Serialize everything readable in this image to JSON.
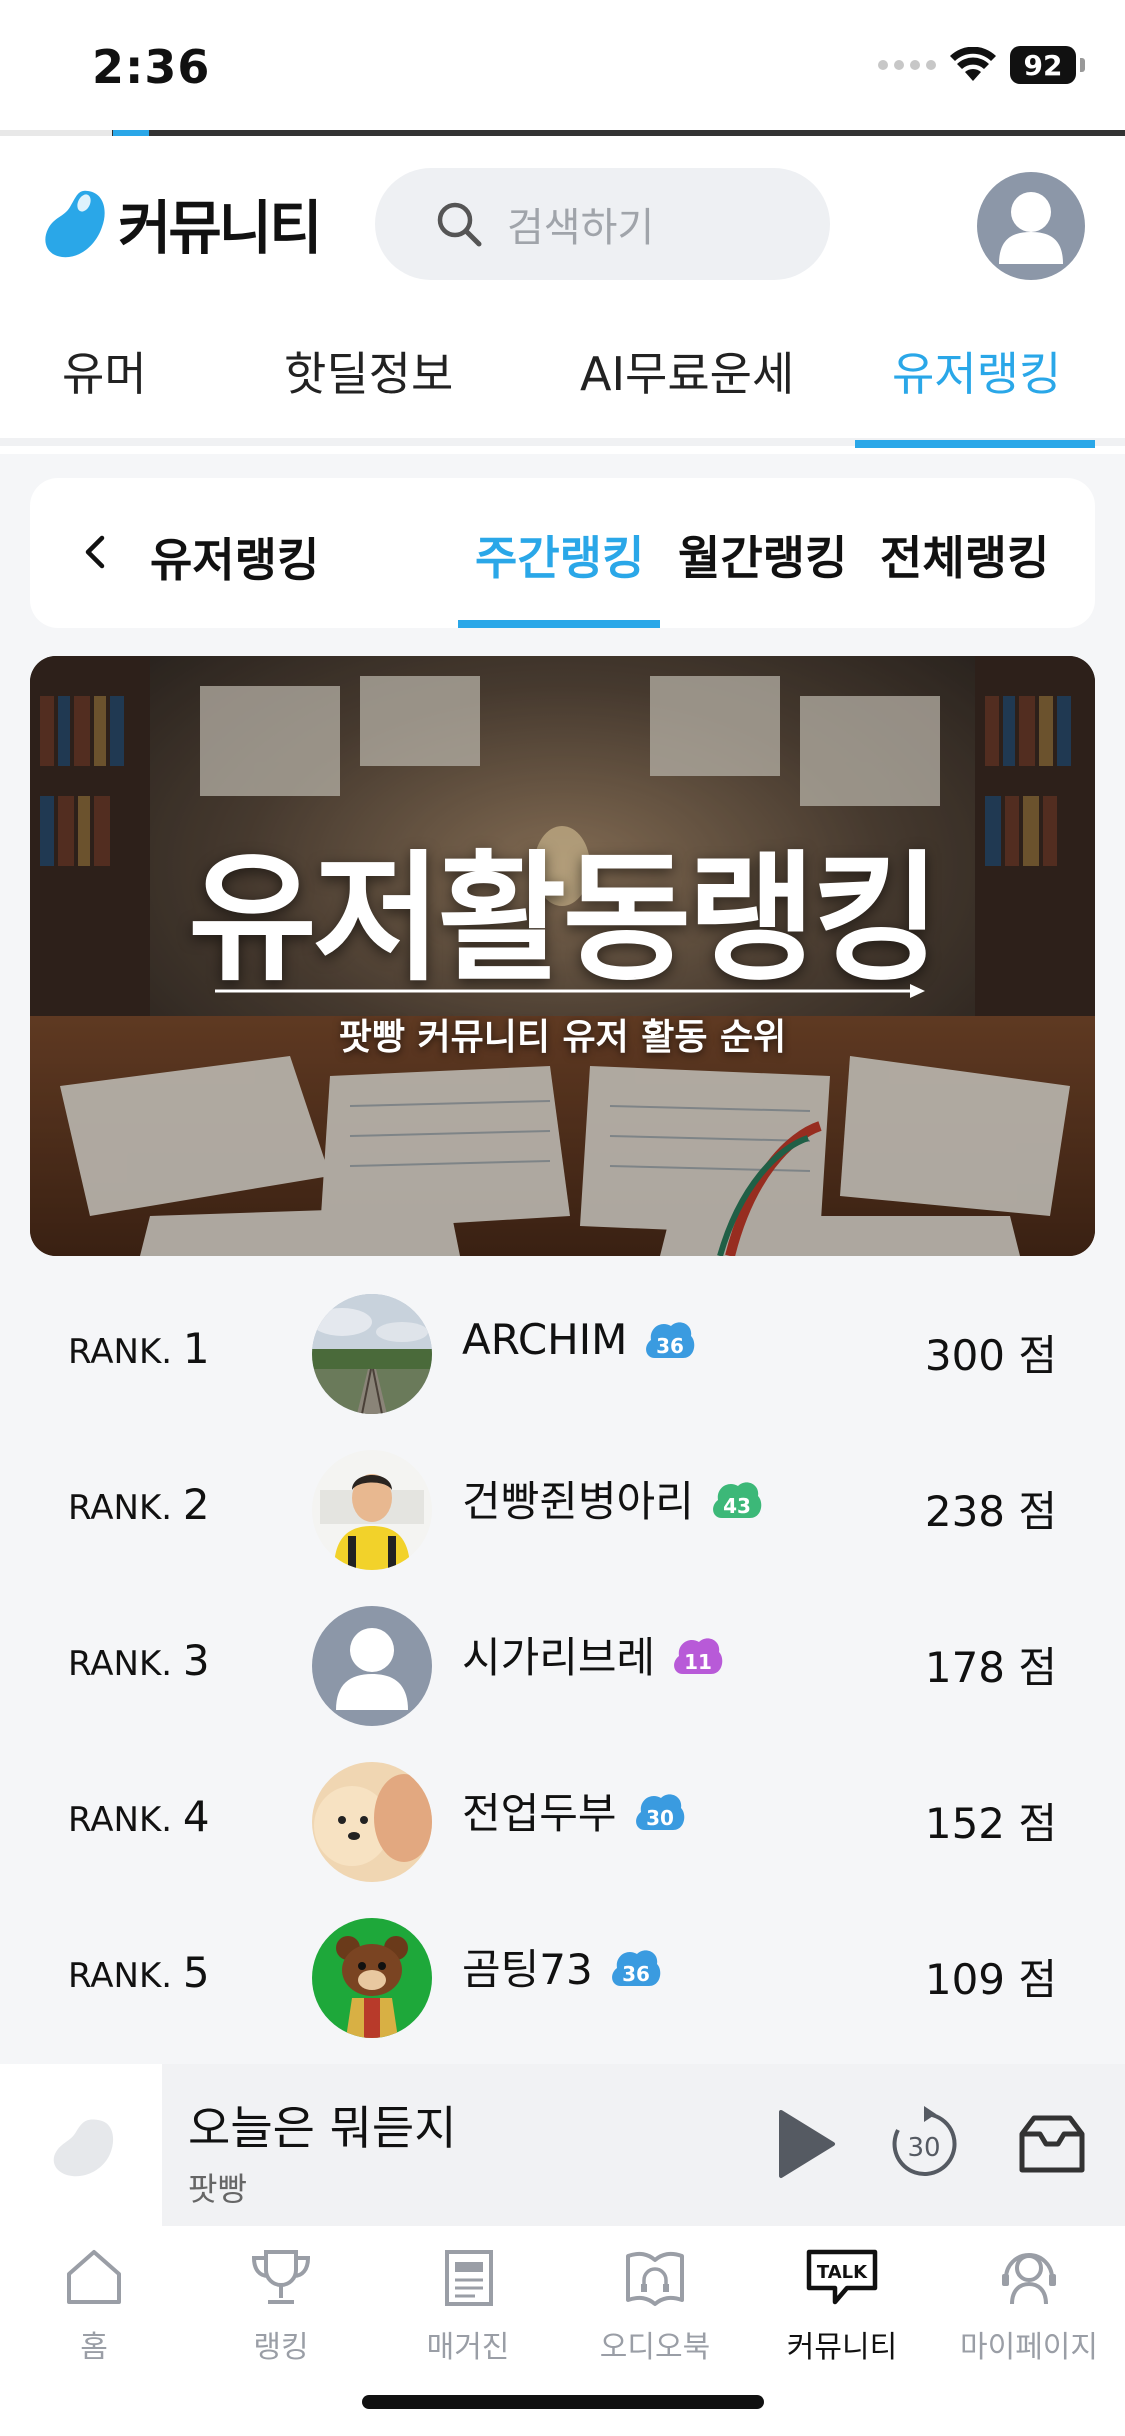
{
  "status_bar": {
    "time": "2:36",
    "battery": "92"
  },
  "progress": {
    "fraction": 0.08
  },
  "header": {
    "logo_text": "커뮤니티",
    "search_placeholder": "검색하기",
    "icons": [
      "bean-logo-icon",
      "search-icon",
      "profile-avatar-icon"
    ]
  },
  "main_tabs": [
    {
      "label": "유머",
      "active": false
    },
    {
      "label": "핫딜정보",
      "active": false
    },
    {
      "label": "AI무료운세",
      "active": false
    },
    {
      "label": "유저랭킹",
      "active": true
    }
  ],
  "sub_nav": {
    "title": "유저랭킹",
    "tabs": [
      {
        "label": "주간랭킹",
        "active": true
      },
      {
        "label": "월간랭킹",
        "active": false
      },
      {
        "label": "전체랭킹",
        "active": false
      }
    ]
  },
  "banner": {
    "title": "유저활동랭킹",
    "subtitle": "팟빵 커뮤니티 유저 활동 순위"
  },
  "rankings": [
    {
      "rank_prefix": "RANK.",
      "rank": "1",
      "name": "ARCHIM",
      "level": "36",
      "badge_color": "#3a9be0",
      "score": "300 점",
      "avatar": "landscape"
    },
    {
      "rank_prefix": "RANK.",
      "rank": "2",
      "name": "건빵쥔병아리",
      "level": "43",
      "badge_color": "#3cb878",
      "score": "238 점",
      "avatar": "person"
    },
    {
      "rank_prefix": "RANK.",
      "rank": "3",
      "name": "시가리브레",
      "level": "11",
      "badge_color": "#b85ad8",
      "score": "178 점",
      "avatar": "default"
    },
    {
      "rank_prefix": "RANK.",
      "rank": "4",
      "name": "전업두부",
      "level": "30",
      "badge_color": "#3a9be0",
      "score": "152 점",
      "avatar": "dog"
    },
    {
      "rank_prefix": "RANK.",
      "rank": "5",
      "name": "곰팅73",
      "level": "36",
      "badge_color": "#3a9be0",
      "score": "109 점",
      "avatar": "bear"
    }
  ],
  "player": {
    "title": "오늘은 뭐듣지",
    "subtitle": "팟빵",
    "skip_label": "30"
  },
  "bottom_nav": [
    {
      "label": "홈",
      "icon": "home-icon",
      "active": false
    },
    {
      "label": "랭킹",
      "icon": "trophy-icon",
      "active": false
    },
    {
      "label": "매거진",
      "icon": "magazine-icon",
      "active": false
    },
    {
      "label": "오디오북",
      "icon": "audiobook-icon",
      "active": false
    },
    {
      "label": "커뮤니티",
      "icon": "talk-icon",
      "active": true
    },
    {
      "label": "마이페이지",
      "icon": "mypage-icon",
      "active": false
    }
  ],
  "colors": {
    "accent": "#2aa7e8",
    "background": "#f5f6f8"
  }
}
